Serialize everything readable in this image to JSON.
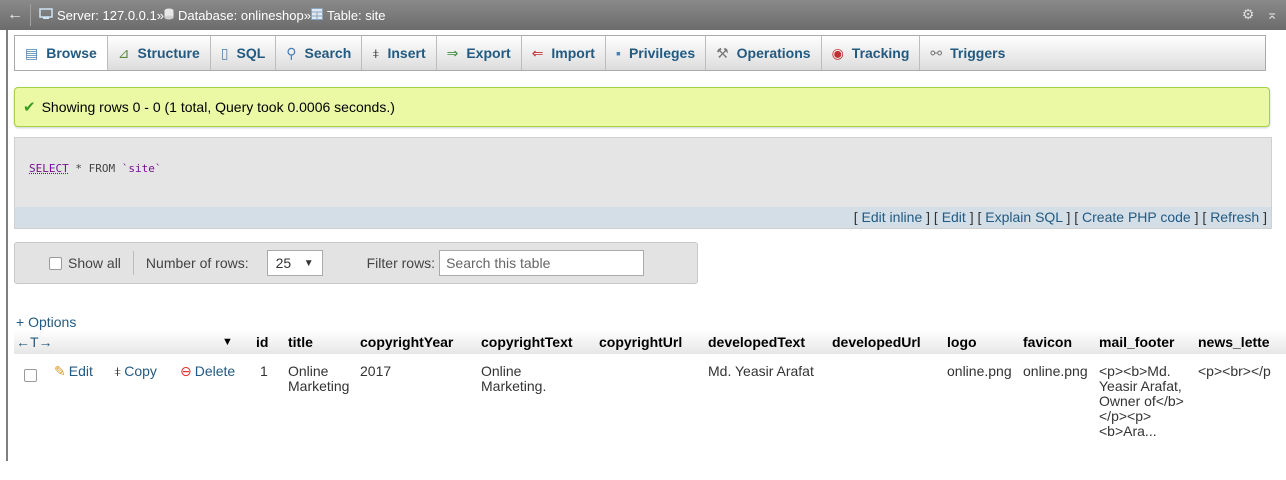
{
  "serverbar": {
    "server": "Server: 127.0.0.1",
    "database": "Database: onlineshop",
    "table": "Table: site",
    "separator": "»"
  },
  "tabs": [
    {
      "label": "Browse",
      "icon": "browse-icon"
    },
    {
      "label": "Structure",
      "icon": "structure-icon"
    },
    {
      "label": "SQL",
      "icon": "sql-icon"
    },
    {
      "label": "Search",
      "icon": "search-icon"
    },
    {
      "label": "Insert",
      "icon": "insert-icon"
    },
    {
      "label": "Export",
      "icon": "export-icon"
    },
    {
      "label": "Import",
      "icon": "import-icon"
    },
    {
      "label": "Privileges",
      "icon": "privileges-icon"
    },
    {
      "label": "Operations",
      "icon": "operations-icon"
    },
    {
      "label": "Tracking",
      "icon": "tracking-icon"
    },
    {
      "label": "Triggers",
      "icon": "triggers-icon"
    }
  ],
  "message": {
    "text": "Showing rows 0 - 0 (1 total, Query took 0.0006 seconds.)",
    "color": "#ebf8a4"
  },
  "query": {
    "keyword": "SELECT",
    "rest": " * FROM ",
    "table": "`site`"
  },
  "query_links": [
    "Edit inline",
    "Edit",
    "Explain SQL",
    "Create PHP code",
    "Refresh"
  ],
  "nav": {
    "show_all": "Show all",
    "rows_label": "Number of rows:",
    "rows_value": "25",
    "filter_label": "Filter rows:",
    "filter_placeholder": "Search this table"
  },
  "options_label": "+ Options",
  "table": {
    "columns": [
      "id",
      "title",
      "copyrightYear",
      "copyrightText",
      "copyrightUrl",
      "developedText",
      "developedUrl",
      "logo",
      "favicon",
      "mail_footer",
      "news_lette"
    ],
    "row": {
      "actions": {
        "edit": "Edit",
        "copy": "Copy",
        "delete": "Delete"
      },
      "id": "1",
      "title": "Online Marketing",
      "copyrightYear": "2017",
      "copyrightText": "Online Marketing.",
      "copyrightUrl": "",
      "developedText": "Md. Yeasir Arafat",
      "developedUrl": "",
      "logo": "online.png",
      "favicon": "online.png",
      "mail_footer": "<p><b>Md. Yeasir Arafat, Owner of</b></p><p><b>Ara...",
      "news_lette": "<p><br></p"
    }
  },
  "colors": {
    "link": "#235a81",
    "success_border": "#a2d246",
    "bar": "#6c6c6c"
  }
}
